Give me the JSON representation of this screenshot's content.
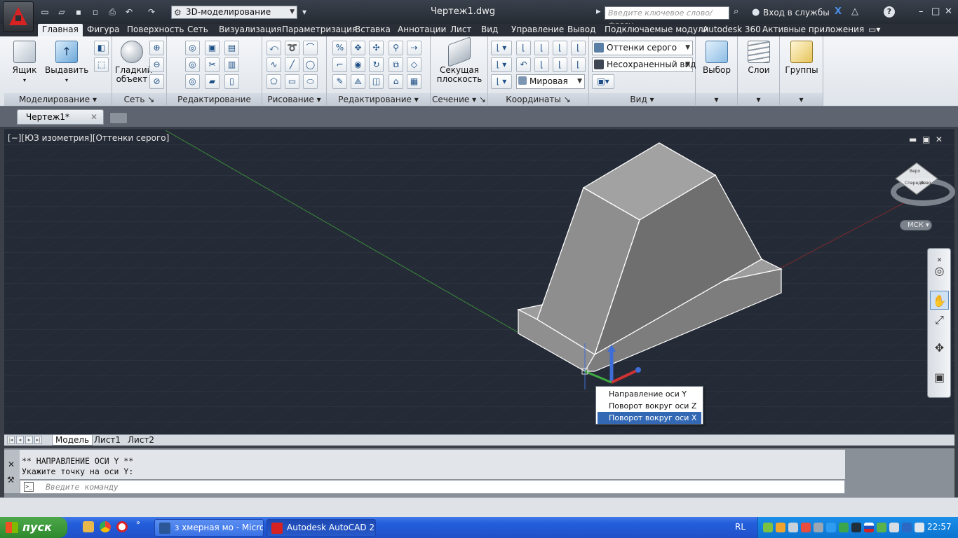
{
  "title_bar": {
    "doc_title": "Чертеж1.dwg",
    "workspace": "3D-моделирование",
    "search_placeholder": "Введите ключевое слово/фразу",
    "signin": "Вход в службы"
  },
  "ribbon_tabs": [
    "Главная",
    "Фигура",
    "Поверхность",
    "Сеть",
    "Визуализация",
    "Параметризация",
    "Вставка",
    "Аннотации",
    "Лист",
    "Вид",
    "Управление",
    "Вывод",
    "Подключаемые модули",
    "Autodesk 360",
    "Активные приложения"
  ],
  "ribbon": {
    "box_label": "Ящик",
    "extrude_label": "Выдавить",
    "smooth_object_label": "Гладкий\nобъект",
    "section_plane_label": "Секущая\nплоскость",
    "visual_style": "Оттенки серого",
    "view_state": "Несохраненный вид",
    "coord_system": "Мировая",
    "selection_label": "Выбор",
    "layers_label": "Слои",
    "groups_label": "Группы",
    "panels": [
      "Моделирование",
      "Сеть",
      "Редактирование тела",
      "Рисование",
      "Редактирование",
      "Сечение",
      "Координаты",
      "Вид"
    ]
  },
  "doc_tab": "Чертеж1*",
  "viewport": {
    "label": "[−][ЮЗ изометрия][Оттенки серого]",
    "wcs": "МСК",
    "viewcube_faces": [
      "Верх",
      "Спереди",
      "Лево"
    ]
  },
  "context_menu": {
    "items": [
      "Направление оси Y",
      "Поворот вокруг оси Z",
      "Поворот вокруг оси X"
    ],
    "highlighted_index": 2
  },
  "layout_tabs": [
    "Модель",
    "Лист1",
    "Лист2"
  ],
  "command": {
    "history_line1": "** НАПРАВЛЕНИЕ ОСИ Y **",
    "history_line2": "Укажите точку на оси Y:",
    "input_placeholder": "Введите команду"
  },
  "taskbar": {
    "start_label": "пуск",
    "tasks": [
      "з хмерная мо - Micro...",
      "Autodesk AutoCAD 2..."
    ],
    "lang": "RL",
    "clock": "22:57"
  },
  "colors": {
    "viewport_bg": "#252b36",
    "accent_red": "#d62222",
    "menu_highlight": "#3368b4",
    "xp_blue": "#245edb"
  }
}
